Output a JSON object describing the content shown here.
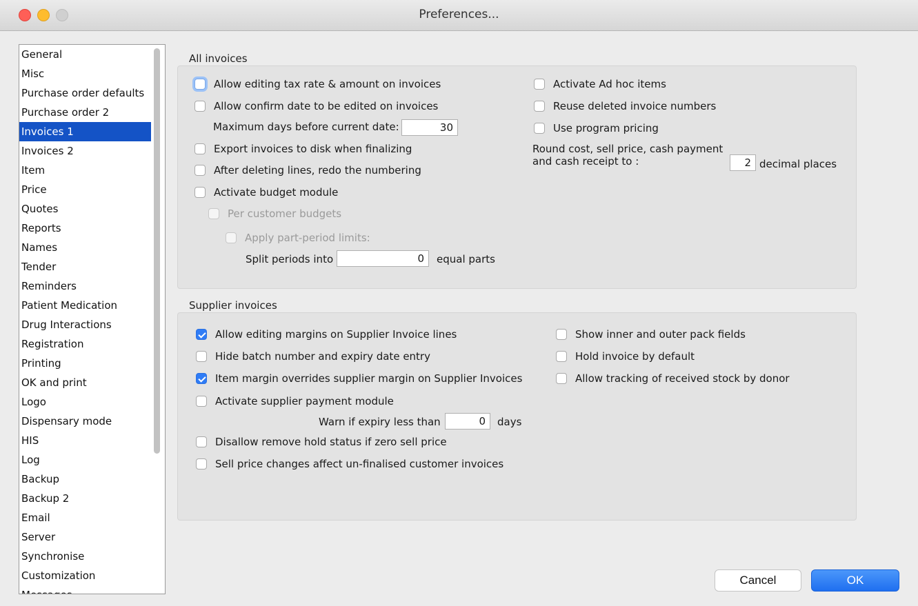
{
  "window": {
    "title": "Preferences..."
  },
  "sidebar": {
    "selected_index": 4,
    "items": [
      "General",
      "Misc",
      "Purchase order defaults",
      "Purchase order 2",
      "Invoices 1",
      "Invoices 2",
      "Item",
      "Price",
      "Quotes",
      "Reports",
      "Names",
      "Tender",
      "Reminders",
      "Patient Medication",
      "Drug Interactions",
      "Registration",
      "Printing",
      "OK and print",
      "Logo",
      "Dispensary mode",
      "HIS",
      "Log",
      "Backup",
      "Backup 2",
      "Email",
      "Server",
      "Synchronise",
      "Customization",
      "Messages"
    ]
  },
  "all_invoices": {
    "label": "All invoices",
    "allow_edit_tax": {
      "label": "Allow editing tax rate & amount on invoices",
      "checked": false
    },
    "allow_confirm_date": {
      "label": "Allow confirm date to be edited on invoices",
      "checked": false
    },
    "max_days_label": "Maximum days before current date:",
    "max_days_value": "30",
    "export_to_disk": {
      "label": "Export invoices to disk when finalizing",
      "checked": false
    },
    "redo_numbering": {
      "label": "After deleting lines, redo the numbering",
      "checked": false
    },
    "budget_module": {
      "label": "Activate budget module",
      "checked": false
    },
    "per_customer_budgets": {
      "label": "Per customer budgets",
      "checked": false
    },
    "part_period_limits": {
      "label": "Apply part-period limits:",
      "checked": false
    },
    "split_periods_label": "Split periods into",
    "split_periods_value": "0",
    "split_periods_suffix": "equal parts",
    "ad_hoc_items": {
      "label": "Activate Ad hoc items",
      "checked": false
    },
    "reuse_numbers": {
      "label": "Reuse deleted invoice numbers",
      "checked": false
    },
    "program_pricing": {
      "label": "Use program pricing",
      "checked": false
    },
    "round_label_1": "Round cost, sell price, cash payment",
    "round_label_2": "and cash receipt to :",
    "round_value": "2",
    "round_suffix": "decimal places"
  },
  "supplier_invoices": {
    "label": "Supplier invoices",
    "editing_margins": {
      "label": "Allow editing margins on Supplier Invoice lines",
      "checked": true
    },
    "hide_batch": {
      "label": "Hide batch number and expiry date entry",
      "checked": false
    },
    "item_margin_override": {
      "label": "Item margin overrides supplier margin on Supplier Invoices",
      "checked": true
    },
    "payment_module": {
      "label": "Activate supplier payment module",
      "checked": false
    },
    "warn_expiry_label": "Warn if expiry less than",
    "warn_expiry_value": "0",
    "warn_expiry_suffix": "days",
    "disallow_hold": {
      "label": "Disallow remove hold status if zero sell price",
      "checked": false
    },
    "sell_price_changes": {
      "label": "Sell price changes affect un-finalised customer invoices",
      "checked": false
    },
    "inner_outer_pack": {
      "label": "Show inner and outer pack fields",
      "checked": false
    },
    "hold_by_default": {
      "label": "Hold invoice by default",
      "checked": false
    },
    "track_by_donor": {
      "label": "Allow tracking of received stock by donor",
      "checked": false
    }
  },
  "buttons": {
    "cancel": "Cancel",
    "ok": "OK"
  },
  "colors": {
    "selection": "#1453c6",
    "checkbox_checked": "#2f7cf6",
    "ok_button": "#1f6ff0"
  }
}
